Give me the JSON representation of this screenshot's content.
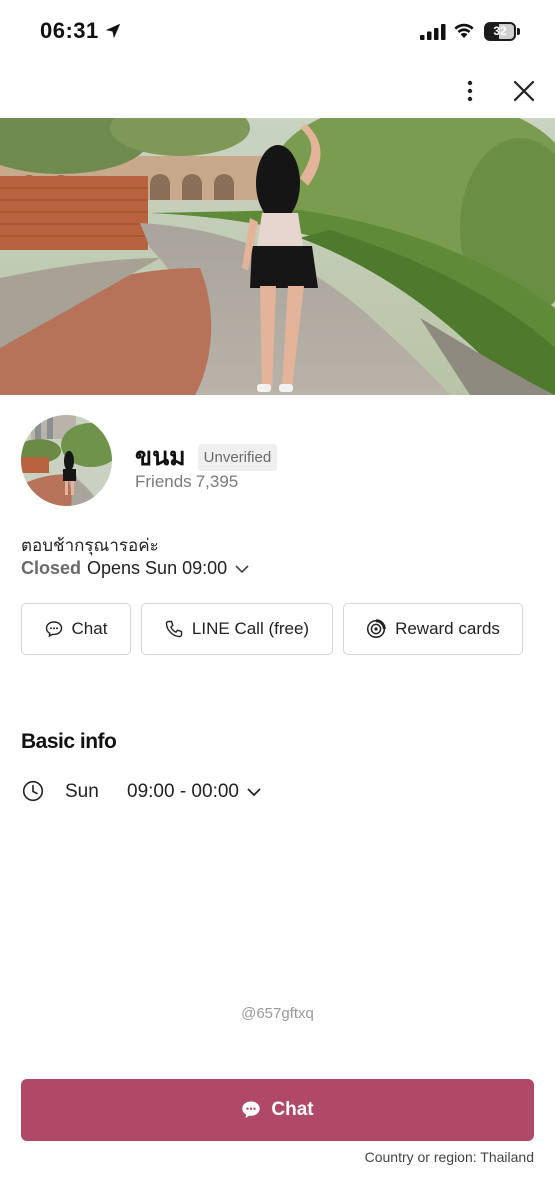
{
  "status_bar": {
    "time": "06:31",
    "battery_level": "32",
    "icons": [
      "location-arrow-icon",
      "cellular-signal-icon",
      "wifi-icon",
      "battery-icon"
    ]
  },
  "top_bar": {
    "icons": [
      "more-vertical-icon",
      "close-icon"
    ]
  },
  "profile": {
    "name": "ขนม",
    "badge": "Unverified",
    "friends_label": "Friends",
    "friends_count": "7,395",
    "status_message": "ตอบช้ากรุณารอค่ะ",
    "hours_state": "Closed",
    "hours_next": "Opens Sun 09:00"
  },
  "actions": {
    "chat": "Chat",
    "call": "LINE Call (free)",
    "reward": "Reward cards"
  },
  "basic_info": {
    "title": "Basic info",
    "day": "Sun",
    "hours": "09:00 - 00:00"
  },
  "footer": {
    "account_id": "@657gftxq",
    "chat_button": "Chat",
    "region": "Country or region: Thailand"
  },
  "colors": {
    "accent": "#b04868",
    "muted_text": "#7a7a7a",
    "border": "#d6d6d6"
  }
}
